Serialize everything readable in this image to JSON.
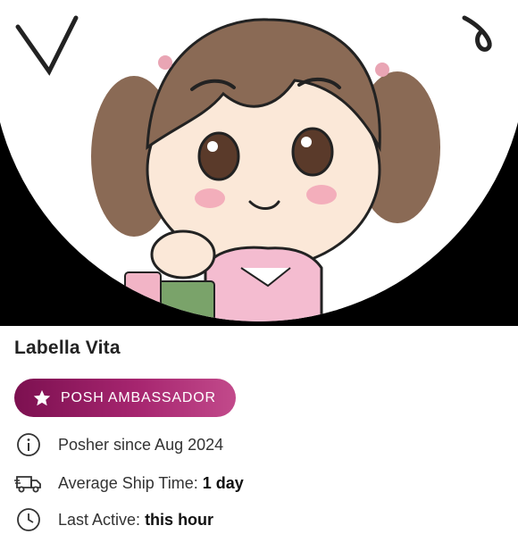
{
  "profile": {
    "name": "Labella Vita",
    "badge_label": "POSH AMBASSADOR",
    "colors": {
      "badge_start": "#7c1050",
      "badge_end": "#c24a8b",
      "hero_bg": "#000000"
    }
  },
  "info_rows": [
    {
      "icon": "info-circle-icon",
      "text": "Posher since Aug 2024",
      "value": ""
    },
    {
      "icon": "delivery-truck-icon",
      "text": "Average Ship Time:",
      "value": "1 day"
    },
    {
      "icon": "clock-icon",
      "text": "Last Active:",
      "value": "this hour"
    }
  ]
}
